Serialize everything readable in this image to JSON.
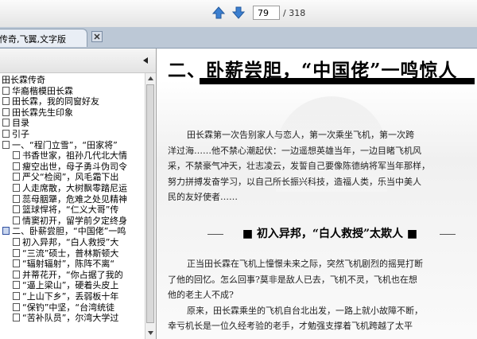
{
  "toolbar": {
    "page_current": "79",
    "page_total": "/ 318",
    "prev_icon": "arrow-up-icon",
    "next_icon": "arrow-down-icon"
  },
  "tab": {
    "label": "传奇,飞翼,文字版"
  },
  "sidebar": {
    "items": [
      {
        "label": "田长霖传奇",
        "box": false
      },
      {
        "label": "华裔楷模田长霖",
        "box": true
      },
      {
        "label": "田长霖，我的同窗好友",
        "box": true
      },
      {
        "label": "田长霖先生印象",
        "box": true
      },
      {
        "label": "目录",
        "box": true
      },
      {
        "label": "引子",
        "box": true
      },
      {
        "label": "一、“程门立雪”，“田家将”",
        "box": true
      },
      {
        "label": "书香世家，祖孙几代北大情",
        "box": true
      },
      {
        "label": "瘦空出世，母子勇斗伪司令",
        "box": true
      },
      {
        "label": "严父“检阅”，风毛霜下出",
        "box": true
      },
      {
        "label": "人走席散，大树飘零踏尼运",
        "box": true
      },
      {
        "label": "蕊母胭犟，危难之处见精神",
        "box": true
      },
      {
        "label": "篮球悍将，“仁义大哥”传",
        "box": true
      },
      {
        "label": "情窦初开，留学前夕定终身",
        "box": true
      },
      {
        "label": "二、卧薪尝胆，“中国佬”一鸣",
        "box": true,
        "blue": true
      },
      {
        "label": "初入异邦，“白人救授”大",
        "box": true
      },
      {
        "label": "“三流”硕士，普林斯顿大",
        "box": true
      },
      {
        "label": "“辐射辐射”，陈阵不离“",
        "box": true
      },
      {
        "label": "并蒂花开，“你占据了我的",
        "box": true
      },
      {
        "label": "“逼上梁山”，硬着头皮上",
        "box": true
      },
      {
        "label": "“上山下乡”，丢弱板十年",
        "box": true
      },
      {
        "label": "“保钓”中坚，“台湾统徒",
        "box": true
      },
      {
        "label": "“苦补队员”，尔湾大学过",
        "box": true
      }
    ]
  },
  "document": {
    "title": "二、卧薪尝胆，“中国佬”一鸣惊人",
    "paragraph1": [
      "田长霖第一次告别家人与恋人，第一次乘坐飞机，第一次跨",
      "洋过海……他不禁心潮起伏：一边遥想英雄当年，一边目睹飞机风",
      "采，不禁豪气冲天，壮志凌云，发誓自己要像陈德纳将军当年那样，",
      "努力拼搏发奋学习，以自己所长振兴科技，造福人类，乐当中美人",
      "民的友好使者……"
    ],
    "subtitle": "初入异邦，“白人救授”太欺人",
    "paragraph2": [
      "正当田长霖在飞机上憧憬未来之际，突然飞机剧烈的摇晃打断",
      "了他的回忆。怎么回事?莫非是敌人已去，飞机不灵，飞机也在想",
      "他的老主人不成?",
      "原来，田长霖乘坐的飞机自台北出发，一路上就小故障不断，",
      "幸亏机长是一位久经考验的老手，才勉强支撑着飞机跨越了太平"
    ]
  }
}
